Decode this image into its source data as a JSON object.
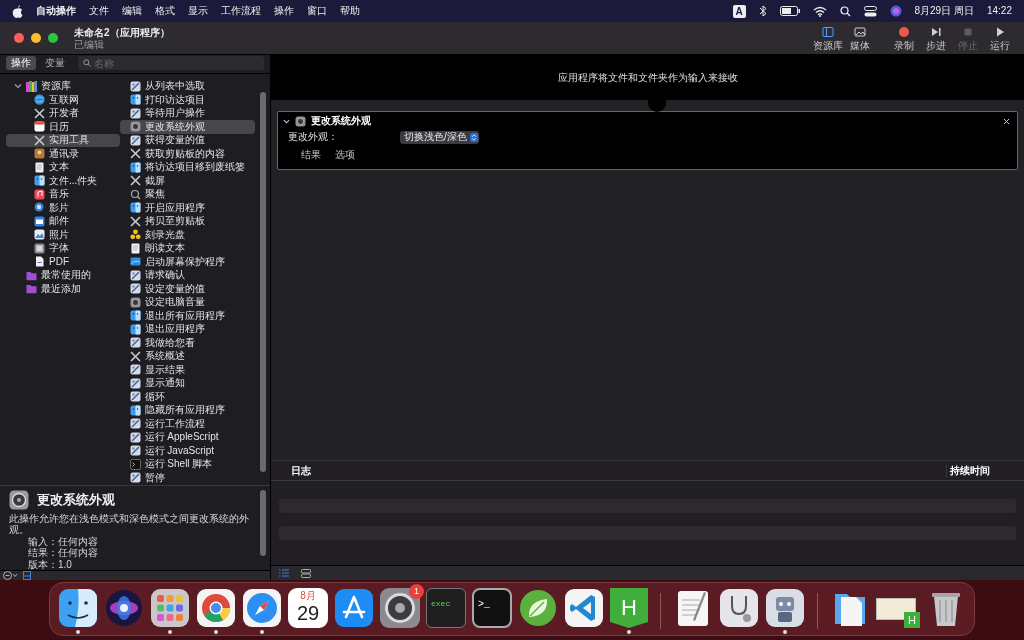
{
  "menu_bar": {
    "items": [
      "自动操作",
      "文件",
      "编辑",
      "格式",
      "显示",
      "工作流程",
      "操作",
      "窗口",
      "帮助"
    ],
    "input_source": "A",
    "date": "8月29日 周日",
    "time": "14:22"
  },
  "window": {
    "title": "未命名2（应用程序）",
    "subtitle": "已编辑",
    "toolbar": [
      {
        "label": "资源库",
        "kind": "library",
        "disabled": false
      },
      {
        "label": "媒体",
        "kind": "media",
        "disabled": false
      },
      {
        "label": "录制",
        "kind": "record",
        "disabled": false
      },
      {
        "label": "步进",
        "kind": "step",
        "disabled": false
      },
      {
        "label": "停止",
        "kind": "stop",
        "disabled": true
      },
      {
        "label": "运行",
        "kind": "run",
        "disabled": false
      }
    ]
  },
  "sidebar": {
    "tabs": [
      {
        "label": "操作",
        "selected": true
      },
      {
        "label": "变量",
        "selected": false
      }
    ],
    "search": {
      "placeholder": "名称"
    },
    "library": [
      {
        "label": "资源库",
        "kind": "library",
        "expanded": true,
        "selected": false,
        "children": [
          {
            "label": "互联网",
            "kind": "globe",
            "selected": false
          },
          {
            "label": "开发者",
            "kind": "tools",
            "selected": false
          },
          {
            "label": "日历",
            "kind": "calendar",
            "selected": false
          },
          {
            "label": "实用工具",
            "kind": "tools",
            "selected": true
          },
          {
            "label": "通讯录",
            "kind": "contacts",
            "selected": false
          },
          {
            "label": "文本",
            "kind": "text",
            "selected": false
          },
          {
            "label": "文件...件夹",
            "kind": "finder",
            "selected": false
          },
          {
            "label": "音乐",
            "kind": "music",
            "selected": false
          },
          {
            "label": "影片",
            "kind": "movie",
            "selected": false
          },
          {
            "label": "邮件",
            "kind": "mail",
            "selected": false
          },
          {
            "label": "照片",
            "kind": "photo",
            "selected": false
          },
          {
            "label": "字体",
            "kind": "font",
            "selected": false
          },
          {
            "label": "PDF",
            "kind": "pdf",
            "selected": false
          }
        ]
      },
      {
        "label": "最常使用的",
        "kind": "folder",
        "selected": false
      },
      {
        "label": "最近添加",
        "kind": "folder",
        "selected": false
      }
    ],
    "actions": [
      {
        "label": "从列表中选取",
        "kind": "workflow",
        "selected": false
      },
      {
        "label": "打印访达项目",
        "kind": "finder",
        "selected": false
      },
      {
        "label": "等待用户操作",
        "kind": "workflow",
        "selected": false
      },
      {
        "label": "更改系统外观",
        "kind": "gear",
        "selected": true
      },
      {
        "label": "获得变量的值",
        "kind": "workflow",
        "selected": false
      },
      {
        "label": "获取剪贴板的内容",
        "kind": "tools",
        "selected": false
      },
      {
        "label": "将访达项目移到废纸篓",
        "kind": "finder",
        "selected": false
      },
      {
        "label": "截屏",
        "kind": "tools",
        "selected": false
      },
      {
        "label": "聚焦",
        "kind": "search",
        "selected": false
      },
      {
        "label": "开启应用程序",
        "kind": "finder",
        "selected": false
      },
      {
        "label": "拷贝至剪贴板",
        "kind": "tools",
        "selected": false
      },
      {
        "label": "刻录光盘",
        "kind": "disc",
        "selected": false
      },
      {
        "label": "朗读文本",
        "kind": "doc",
        "selected": false
      },
      {
        "label": "启动屏幕保护程序",
        "kind": "screen",
        "selected": false
      },
      {
        "label": "请求确认",
        "kind": "workflow",
        "selected": false
      },
      {
        "label": "设定变量的值",
        "kind": "workflow",
        "selected": false
      },
      {
        "label": "设定电脑音量",
        "kind": "gear",
        "selected": false
      },
      {
        "label": "退出所有应用程序",
        "kind": "finder",
        "selected": false
      },
      {
        "label": "退出应用程序",
        "kind": "finder",
        "selected": false
      },
      {
        "label": "我做给您看",
        "kind": "workflow",
        "selected": false
      },
      {
        "label": "系统概述",
        "kind": "tools",
        "selected": false
      },
      {
        "label": "显示结果",
        "kind": "workflow",
        "selected": false
      },
      {
        "label": "显示通知",
        "kind": "workflow",
        "selected": false
      },
      {
        "label": "循环",
        "kind": "workflow",
        "selected": false
      },
      {
        "label": "隐藏所有应用程序",
        "kind": "finder",
        "selected": false
      },
      {
        "label": "运行工作流程",
        "kind": "workflow",
        "selected": false
      },
      {
        "label": "运行 AppleScript",
        "kind": "workflow",
        "selected": false
      },
      {
        "label": "运行 JavaScript",
        "kind": "workflow",
        "selected": false
      },
      {
        "label": "运行 Shell 脚本",
        "kind": "terminal",
        "selected": false
      },
      {
        "label": "暂停",
        "kind": "workflow",
        "selected": false
      }
    ],
    "description": {
      "title": "更改系统外观",
      "text": "此操作允许您在浅色模式和深色模式之间更改系统的外观。",
      "fields": [
        {
          "label": "输入：",
          "value": "任何内容"
        },
        {
          "label": "结果：",
          "value": "任何内容"
        },
        {
          "label": "版本：",
          "value": "1.0"
        }
      ]
    }
  },
  "workflow": {
    "header": "应用程序将文件和文件夹作为输入来接收",
    "action": {
      "title": "更改系统外观",
      "expanded": true,
      "field_label": "更改外观：",
      "value": "切换浅色/深色",
      "tabs": [
        "结果",
        "选项"
      ]
    }
  },
  "log": {
    "columns": [
      "日志",
      "持续时间"
    ]
  },
  "dock": [
    {
      "kind": "finder",
      "running": true
    },
    {
      "kind": "siri",
      "running": false
    },
    {
      "kind": "launchpad",
      "running": true
    },
    {
      "kind": "chrome",
      "running": true
    },
    {
      "kind": "safari",
      "running": true
    },
    {
      "kind": "calendar",
      "running": false,
      "month": "8月",
      "day": "29"
    },
    {
      "kind": "appstore",
      "running": false
    },
    {
      "kind": "settings",
      "running": false,
      "badge": "1"
    },
    {
      "kind": "console",
      "running": false,
      "label": "exec"
    },
    {
      "kind": "terminal",
      "running": false,
      "label": ">_"
    },
    {
      "kind": "leaf",
      "running": false
    },
    {
      "kind": "vscode",
      "running": false
    },
    {
      "kind": "hbuilder",
      "running": true,
      "label": "H"
    },
    {
      "kind": "separator"
    },
    {
      "kind": "textedit",
      "running": false
    },
    {
      "kind": "sysinfo",
      "running": false
    },
    {
      "kind": "automator",
      "running": true
    },
    {
      "kind": "separator"
    },
    {
      "kind": "documents",
      "running": false
    },
    {
      "kind": "preview",
      "running": false,
      "label": "H"
    },
    {
      "kind": "trash",
      "running": false
    }
  ]
}
